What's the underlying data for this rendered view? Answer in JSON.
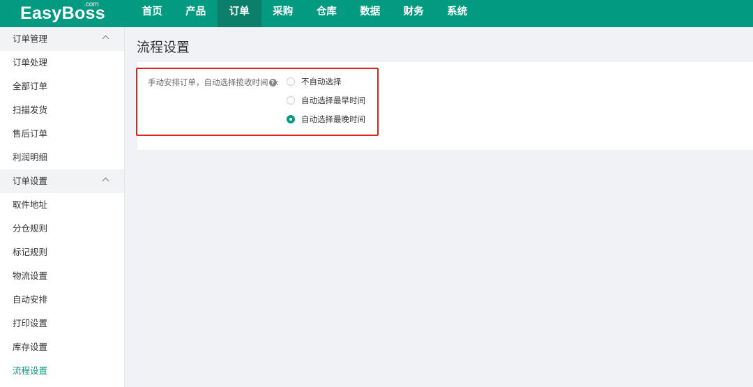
{
  "app": {
    "logo": "EasyBoss",
    "logo_sup": ".com"
  },
  "nav": [
    {
      "label": "首页"
    },
    {
      "label": "产品"
    },
    {
      "label": "订单",
      "active": true
    },
    {
      "label": "采购"
    },
    {
      "label": "仓库"
    },
    {
      "label": "数据"
    },
    {
      "label": "财务"
    },
    {
      "label": "系统"
    }
  ],
  "sidebar": {
    "group1": {
      "label": "订单管理"
    },
    "group1_items": [
      "订单处理",
      "全部订单",
      "扫描发货",
      "售后订单",
      "利润明细"
    ],
    "group2": {
      "label": "订单设置"
    },
    "group2_items": [
      "取件地址",
      "分仓规则",
      "标记规则",
      "物流设置",
      "自动安排",
      "打印设置",
      "库存设置",
      "流程设置"
    ],
    "active_item": "流程设置"
  },
  "main": {
    "title": "流程设置",
    "setting": {
      "label": "手动安排订单，自动选择揽收时间",
      "colon": ":",
      "options": [
        {
          "label": "不自动选择",
          "checked": false
        },
        {
          "label": "自动选择最早时间",
          "checked": false
        },
        {
          "label": "自动选择最晚时间",
          "checked": true
        }
      ]
    }
  },
  "colors": {
    "primary": "#029b82",
    "nav_active": "#0b7f6a",
    "highlight": "#e0231b"
  }
}
